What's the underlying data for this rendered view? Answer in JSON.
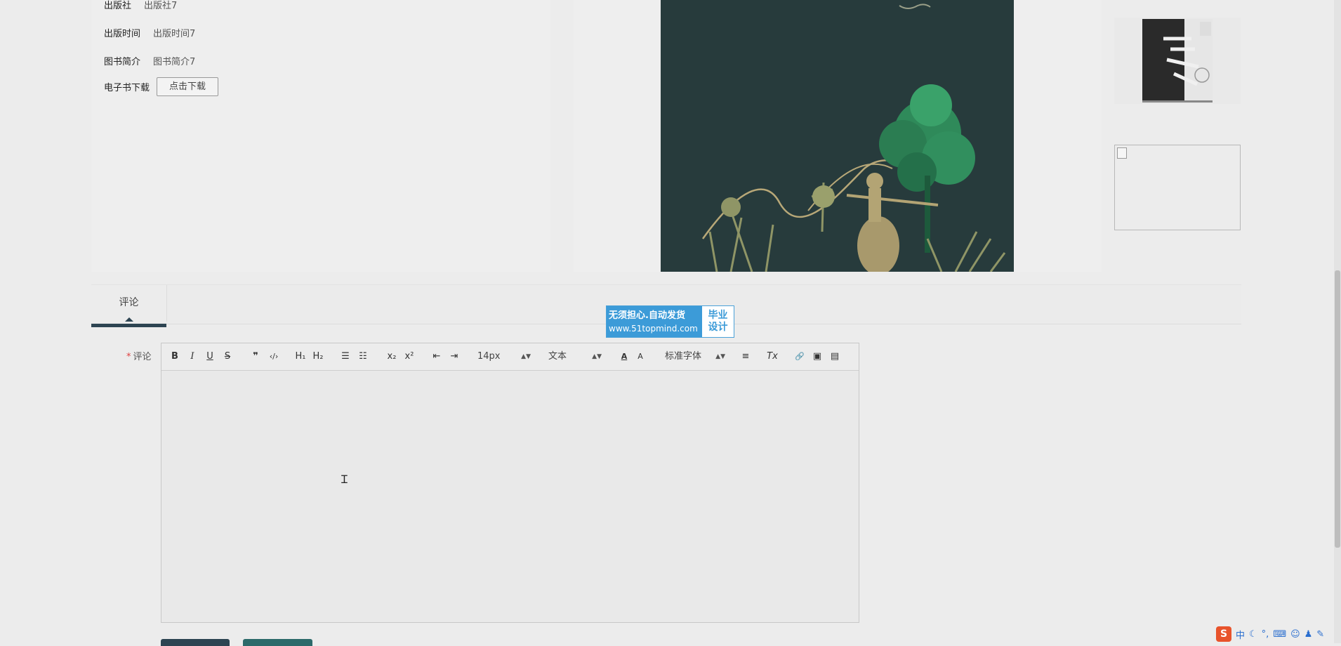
{
  "book_info": {
    "publisher_label": "出版社",
    "publisher_value": "出版社7",
    "pub_date_label": "出版时间",
    "pub_date_value": "出版时间7",
    "intro_label": "图书简介",
    "intro_value": "图书简介7",
    "ebook_label": "电子书下载",
    "download_button": "点击下载"
  },
  "tabs": [
    {
      "label": "评论"
    }
  ],
  "badge": {
    "line1": "无须担心.自动发货",
    "line2": "www.51topmind.com",
    "right_top": "毕业",
    "right_bottom": "设计"
  },
  "comment": {
    "required_mark": "*",
    "label": "评论"
  },
  "toolbar": {
    "bold": "B",
    "italic": "I",
    "underline": "U",
    "strike": "S",
    "quote": "❞",
    "code": "‹/›",
    "h1": "H₁",
    "h2": "H₂",
    "ordered_list": "☰",
    "bullet_list": "☷",
    "subscript": "x₂",
    "superscript": "x²",
    "outdent": "⇤",
    "indent": "⇥",
    "size_value": "14px",
    "header_value": "文本",
    "color": "A",
    "background": "A",
    "font_value": "标准字体",
    "align": "≡",
    "clean": "Tx",
    "link": "🔗",
    "image": "▣",
    "video": "▤"
  },
  "ime": {
    "logo": "S",
    "lang": "中"
  },
  "colors": {
    "accent_dark": "#2d4452",
    "accent_teal": "#2c6a6a",
    "badge_blue": "#3c9bd8"
  }
}
